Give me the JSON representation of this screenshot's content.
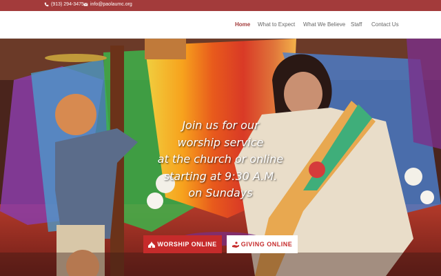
{
  "topbar": {
    "phone": "(913) 294-3475",
    "email": "info@paolaumc.org",
    "phone_icon": "phone-icon",
    "email_icon": "envelope-icon",
    "bg_color": "#a33b3b"
  },
  "nav": {
    "items": [
      {
        "label": "Home",
        "active": true
      },
      {
        "label": "What to Expect",
        "active": false
      },
      {
        "label": "What We Believe",
        "active": false
      },
      {
        "label": "Staff",
        "active": false
      },
      {
        "label": "Contact Us",
        "active": false
      }
    ],
    "active_color": "#a33b3b"
  },
  "hero": {
    "lines": [
      "Join us for our",
      "worship service",
      "at the church or online",
      "starting at 9:30 A.M.",
      "on Sundays"
    ],
    "buttons": {
      "worship": {
        "label": "WORSHIP ONLINE",
        "icon": "church-icon"
      },
      "giving": {
        "label": "GIVING ONLINE",
        "icon": "giving-hand-icon"
      }
    },
    "accent_color": "#c62b2b"
  }
}
